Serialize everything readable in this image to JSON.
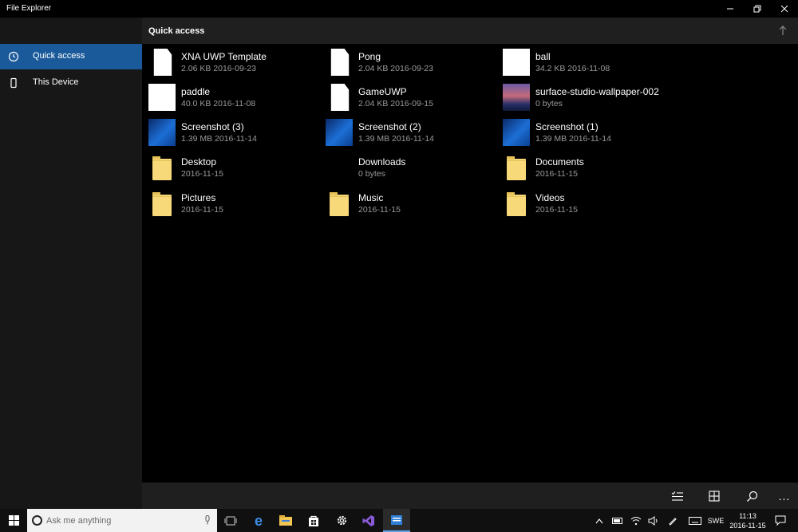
{
  "window": {
    "title": "File Explorer"
  },
  "sidebar": {
    "items": [
      {
        "label": "Quick access",
        "icon": "clock-icon",
        "active": true
      },
      {
        "label": "This Device",
        "icon": "phone-icon",
        "active": false
      }
    ]
  },
  "header": {
    "title": "Quick access",
    "up_icon": "up-arrow-icon"
  },
  "files": [
    {
      "name": "XNA UWP Template",
      "meta": "2.06 KB 2016-09-23",
      "thumb": "file"
    },
    {
      "name": "Pong",
      "meta": "2.04 KB 2016-09-23",
      "thumb": "file"
    },
    {
      "name": "ball",
      "meta": "34.2 KB 2016-11-08",
      "thumb": "white-image"
    },
    {
      "name": "paddle",
      "meta": "40.0 KB 2016-11-08",
      "thumb": "white-image"
    },
    {
      "name": "GameUWP",
      "meta": "2.04 KB 2016-09-15",
      "thumb": "file"
    },
    {
      "name": "surface-studio-wallpaper-002",
      "meta": "0 bytes",
      "thumb": "wallpaper"
    },
    {
      "name": "Screenshot (3)",
      "meta": "1.39 MB 2016-11-14",
      "thumb": "screenshot"
    },
    {
      "name": "Screenshot (2)",
      "meta": "1.39 MB 2016-11-14",
      "thumb": "screenshot"
    },
    {
      "name": "Screenshot (1)",
      "meta": "1.39 MB 2016-11-14",
      "thumb": "screenshot"
    },
    {
      "name": "Desktop",
      "meta": "2016-11-15",
      "thumb": "folder"
    },
    {
      "name": "Downloads",
      "meta": "0 bytes",
      "thumb": "none"
    },
    {
      "name": "Documents",
      "meta": "2016-11-15",
      "thumb": "folder"
    },
    {
      "name": "Pictures",
      "meta": "2016-11-15",
      "thumb": "folder"
    },
    {
      "name": "Music",
      "meta": "2016-11-15",
      "thumb": "folder"
    },
    {
      "name": "Videos",
      "meta": "2016-11-15",
      "thumb": "folder"
    }
  ],
  "commandbar": {
    "buttons": [
      "select-list-icon",
      "grid-view-icon",
      "search-icon",
      "more-icon"
    ],
    "more_label": "..."
  },
  "taskbar": {
    "search_placeholder": "Ask me anything",
    "apps": [
      "task-view-icon",
      "edge-icon",
      "explorer-icon",
      "store-icon",
      "settings-icon",
      "visual-studio-icon",
      "file-explorer-app-icon"
    ],
    "tray": {
      "language": "SWE",
      "time": "11:13",
      "date": "2016-11-15"
    }
  },
  "colors": {
    "accent": "#1a5a9a",
    "sidebar_bg": "#171717",
    "header_bg": "#1f1f1f",
    "folder": "#f7d97a"
  }
}
